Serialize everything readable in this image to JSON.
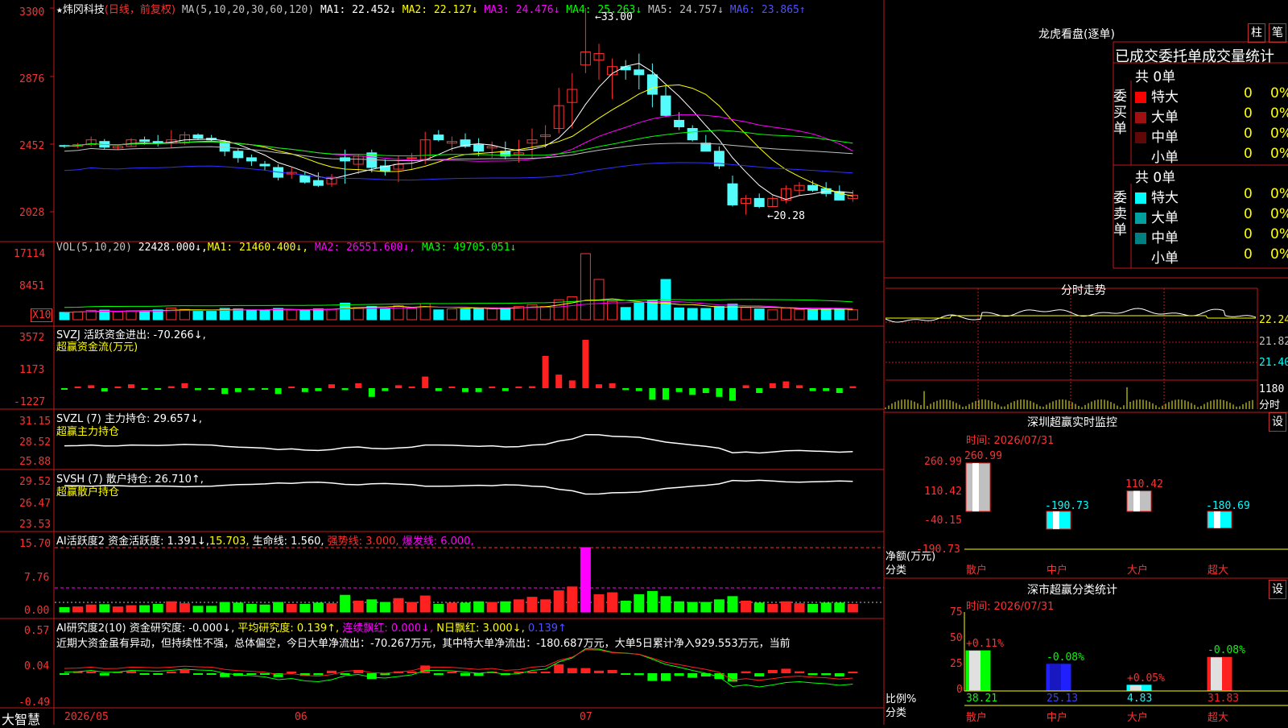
{
  "stock": {
    "star": "★",
    "name": "炜冈科技",
    "period": "(日线，前复权)"
  },
  "ma_line": {
    "label": "MA(5,10,20,30,60,120)",
    "ma1": "MA1: 22.452↓",
    "ma2": "MA2: 22.127↓",
    "ma3": "MA3: 24.476↓",
    "ma4": "MA4: 25.263↓",
    "ma5": "MA5: 24.757↓",
    "ma6": "MA6: 23.865↑"
  },
  "price_axis": [
    "3300",
    "2876",
    "2452",
    "2028"
  ],
  "price_marks": {
    "high": "←33.00",
    "low": "←20.28"
  },
  "vol": {
    "label": "VOL(5,10,20)",
    "value": "22428.000↓,",
    "ma1": "MA1: 21460.400↓,",
    "ma2": "MA2: 26551.600↓,",
    "ma3": "MA3: 49705.051↓",
    "axis": [
      "17114",
      "8451"
    ],
    "unit": "X10"
  },
  "svzj": {
    "label": "SVZJ  活跃资金进出: -70.266↓,",
    "sub": "超赢资金流(万元)",
    "axis": [
      "3572",
      "1173",
      "-1227"
    ]
  },
  "svzl": {
    "label": "SVZL (7) 主力持仓: 29.657↓,",
    "sub": "超赢主力持仓",
    "axis": [
      "31.15",
      "28.52",
      "25.88"
    ]
  },
  "svsh": {
    "label": "SVSH (7) 散户持仓: 26.710↑,",
    "sub": "超赢散户持仓",
    "axis": [
      "29.52",
      "26.47",
      "23.53"
    ]
  },
  "ai1": {
    "label": "AI活跃度2 资金活跃度: 1.391↓,",
    "v2": "15.703,",
    "v3": "生命线: 1.560,",
    "v4": "强势线: 3.000,",
    "v5": "爆发线: 6.000,",
    "axis": [
      "15.70",
      "7.76",
      "0.00"
    ]
  },
  "ai2": {
    "label": "AI研究度2(10) 资金研究度: -0.000↓,",
    "v2": "平均研究度: 0.139↑,",
    "v3": "连续飘红: 0.000↓,",
    "v4": "N日飘红: 3.000↓,",
    "v5": "0.139↑",
    "axis": [
      "0.57",
      "0.04",
      "-0.49"
    ],
    "text": "近期大资金虽有异动，但持续性不强，总体偏空，今日大单净流出：-70.267万元，其中特大单净流出：-180.687万元，大单5日累计净入929.553万元，当前"
  },
  "date_axis": {
    "brand": "大智慧",
    "d1": "2026/05",
    "d2": "06",
    "d3": "07"
  },
  "lhb": {
    "title": "龙虎看盘(逐单)",
    "btn1": "柱",
    "btn2": "笔",
    "tab": "已成交委托单成交量统计",
    "buy_total": "共 0单",
    "sell_total": "共 0单",
    "buy_label": "委买单",
    "sell_label": "委卖单",
    "buy_rows": [
      {
        "name": "特大",
        "n": "0",
        "p": "0%",
        "color": "#ff0000"
      },
      {
        "name": "大单",
        "n": "0",
        "p": "0%",
        "color": "#a01010"
      },
      {
        "name": "中单",
        "n": "0",
        "p": "0%",
        "color": "#600808"
      },
      {
        "name": "小单",
        "n": "0",
        "p": "0%",
        "color": ""
      }
    ],
    "sell_rows": [
      {
        "name": "特大",
        "n": "0",
        "p": "0%",
        "color": "#00ffff"
      },
      {
        "name": "大单",
        "n": "0",
        "p": "0%",
        "color": "#00a0a0"
      },
      {
        "name": "中单",
        "n": "0",
        "p": "0%",
        "color": "#008080"
      },
      {
        "name": "小单",
        "n": "0",
        "p": "0%",
        "color": ""
      }
    ]
  },
  "fenshi": {
    "title": "分时走势",
    "p1": "22.24",
    "p2": "21.82",
    "p3": "21.40",
    "v1": "1180",
    "v2": "分时"
  },
  "szjk": {
    "title": "深圳超赢实时监控",
    "btn": "设",
    "time": "时间: 2026/07/31",
    "axis": [
      "260.99",
      "110.42",
      "-40.15",
      "-190.73"
    ],
    "ylabel": "净额(万元)",
    "xlabel": "分类",
    "bars": [
      {
        "cat": "散户",
        "val": "260.99",
        "v": 260.99
      },
      {
        "cat": "中户",
        "val": "-190.73",
        "v": -190.73
      },
      {
        "cat": "大户",
        "val": "110.42",
        "v": 110.42
      },
      {
        "cat": "超大",
        "val": "-180.69",
        "v": -180.69
      }
    ]
  },
  "scfl": {
    "title": "深市超赢分类统计",
    "btn": "设",
    "time": "时间: 2026/07/31",
    "axis": [
      "75",
      "50",
      "25",
      "0"
    ],
    "ylabel": "比例%",
    "xlabel": "分类",
    "bars": [
      {
        "cat": "散户",
        "pct": "38.21",
        "chg": "+0.11%",
        "v": 38.21
      },
      {
        "cat": "中户",
        "pct": "25.13",
        "chg": "-0.08%",
        "v": 25.13
      },
      {
        "cat": "大户",
        "pct": "4.83",
        "chg": "+0.05%",
        "v": 4.83
      },
      {
        "cat": "超大",
        "pct": "31.83",
        "chg": "-0.08%",
        "v": 31.83
      }
    ]
  },
  "chart_data": {
    "type": "candlestick",
    "candles": [
      [
        24.55,
        24.6,
        24.4,
        24.5
      ],
      [
        24.5,
        24.7,
        24.4,
        24.6
      ],
      [
        24.6,
        25.1,
        24.5,
        24.9
      ],
      [
        24.8,
        24.95,
        24.3,
        24.45
      ],
      [
        24.4,
        24.6,
        24.3,
        24.5
      ],
      [
        24.5,
        25.0,
        24.5,
        24.9
      ],
      [
        24.9,
        25.1,
        24.6,
        24.8
      ],
      [
        24.8,
        25.2,
        24.5,
        24.7
      ],
      [
        24.7,
        25.5,
        24.4,
        24.9
      ],
      [
        24.7,
        25.4,
        24.6,
        25.2
      ],
      [
        25.2,
        25.3,
        24.9,
        25.0
      ],
      [
        25.0,
        25.2,
        24.8,
        24.9
      ],
      [
        24.8,
        24.9,
        23.9,
        24.2
      ],
      [
        24.2,
        24.4,
        23.5,
        23.8
      ],
      [
        23.8,
        24.0,
        23.3,
        23.6
      ],
      [
        23.4,
        23.6,
        23.0,
        23.3
      ],
      [
        23.2,
        23.4,
        22.4,
        22.6
      ],
      [
        22.8,
        23.2,
        22.5,
        22.9
      ],
      [
        22.7,
        22.9,
        22.2,
        22.3
      ],
      [
        22.4,
        22.9,
        22.0,
        22.1
      ],
      [
        22.2,
        22.8,
        22.0,
        22.6
      ],
      [
        23.8,
        24.3,
        22.2,
        23.6
      ],
      [
        23.4,
        24.0,
        22.8,
        23.9
      ],
      [
        24.1,
        24.3,
        22.9,
        23.2
      ],
      [
        23.3,
        23.7,
        22.7,
        23.0
      ],
      [
        23.1,
        23.9,
        22.3,
        23.4
      ],
      [
        23.8,
        24.1,
        23.1,
        23.8
      ],
      [
        23.7,
        25.4,
        23.4,
        24.9
      ],
      [
        25.2,
        25.5,
        24.8,
        24.9
      ],
      [
        24.7,
        25.1,
        24.2,
        24.8
      ],
      [
        24.9,
        25.3,
        24.4,
        24.5
      ],
      [
        24.6,
        25.0,
        23.9,
        24.2
      ],
      [
        24.4,
        24.8,
        23.8,
        24.5
      ],
      [
        24.2,
        24.8,
        23.7,
        23.9
      ],
      [
        24.0,
        24.9,
        23.5,
        24.1
      ],
      [
        24.7,
        25.6,
        23.8,
        24.9
      ],
      [
        25.1,
        25.8,
        24.4,
        25.2
      ],
      [
        25.6,
        28.1,
        25.3,
        27.0
      ],
      [
        27.2,
        29.0,
        25.6,
        28.0
      ],
      [
        29.5,
        33.0,
        29.0,
        30.3
      ],
      [
        29.8,
        30.8,
        28.6,
        30.2
      ],
      [
        28.9,
        29.9,
        27.4,
        29.4
      ],
      [
        29.4,
        29.8,
        28.6,
        29.2
      ],
      [
        29.2,
        30.2,
        28.0,
        28.9
      ],
      [
        28.9,
        29.6,
        26.9,
        27.7
      ],
      [
        27.6,
        28.2,
        26.3,
        26.4
      ],
      [
        26.1,
        26.6,
        25.5,
        25.7
      ],
      [
        25.6,
        25.8,
        24.8,
        24.9
      ],
      [
        24.7,
        25.2,
        24.2,
        24.2
      ],
      [
        24.2,
        24.5,
        23.1,
        23.3
      ],
      [
        22.2,
        22.7,
        20.8,
        20.9
      ],
      [
        21.0,
        21.5,
        20.3,
        21.3
      ],
      [
        21.3,
        21.6,
        20.7,
        20.8
      ],
      [
        20.8,
        21.5,
        20.8,
        21.3
      ],
      [
        21.2,
        22.1,
        21.0,
        21.9
      ],
      [
        21.8,
        22.3,
        21.5,
        22.1
      ],
      [
        22.1,
        22.4,
        21.7,
        21.8
      ],
      [
        21.9,
        22.3,
        21.4,
        21.6
      ],
      [
        21.7,
        22.1,
        21.2,
        21.2
      ],
      [
        21.3,
        21.8,
        21.1,
        21.5
      ]
    ],
    "high_mark": 33.0,
    "low_mark": 20.28,
    "ylim": [
      20.28,
      33.0
    ]
  }
}
